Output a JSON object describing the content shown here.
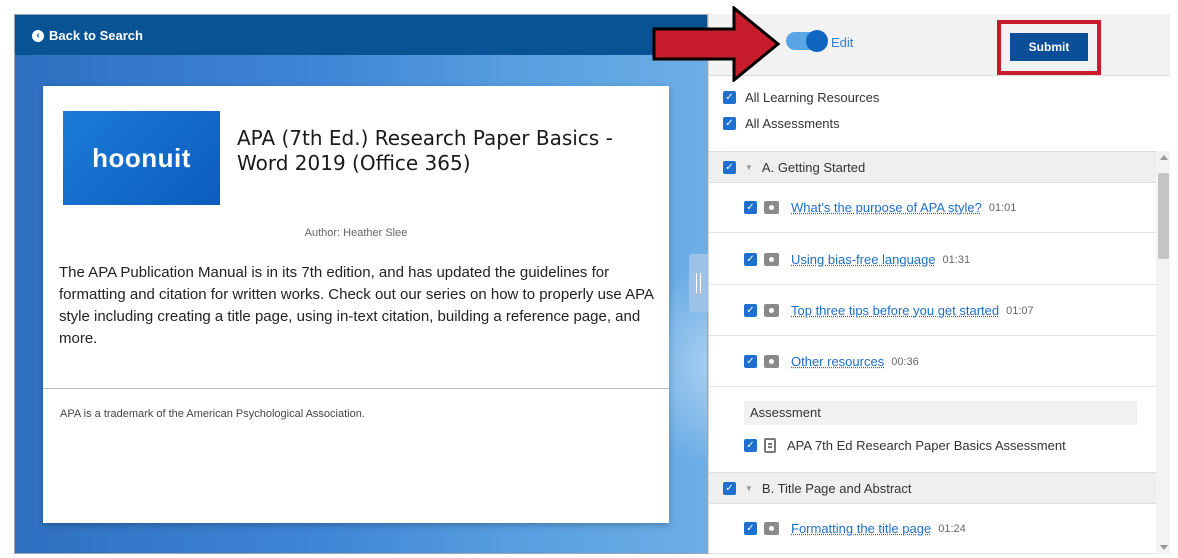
{
  "header": {
    "back_label": "Back to Search"
  },
  "course": {
    "logo_text": "hoonuit",
    "title": "APA (7th Ed.) Research Paper Basics - Word 2019 (Office 365)",
    "author": "Author: Heather Slee",
    "description": "The APA Publication Manual is in its 7th edition, and has updated the guidelines for formatting and citation for written works. Check out our series on how to properly use APA style including creating a title page, using in-text citation, building a reference page, and more.",
    "trademark": "APA is a trademark of the American Psychological Association."
  },
  "toolbar": {
    "edit_label": "Edit",
    "edit_enabled": true,
    "submit_label": "Submit"
  },
  "filters": [
    {
      "label": "All Learning Resources",
      "checked": true
    },
    {
      "label": "All Assessments",
      "checked": true
    }
  ],
  "sections": [
    {
      "title": "A. Getting Started",
      "checked": true,
      "lessons": [
        {
          "title": "What's the purpose of APA style?",
          "duration": "01:01",
          "checked": true
        },
        {
          "title": "Using bias-free language",
          "duration": "01:31",
          "checked": true
        },
        {
          "title": "Top three tips before you get started",
          "duration": "01:07",
          "checked": true
        },
        {
          "title": "Other resources",
          "duration": "00:36",
          "checked": true
        }
      ],
      "assessment_heading": "Assessment",
      "assessment": {
        "title": "APA 7th Ed Research Paper Basics Assessment",
        "checked": true
      }
    },
    {
      "title": "B. Title Page and Abstract",
      "checked": true,
      "lessons": [
        {
          "title": "Formatting the title page",
          "duration": "01:24",
          "checked": true
        }
      ]
    }
  ],
  "colors": {
    "topbar": "#075394",
    "accent_blue": "#1f6fd1",
    "submit_button": "#0b4f98",
    "highlight_red": "#c71c2b"
  },
  "icons": {
    "back": "back-arrow-circle-icon",
    "lesson": "camera-icon",
    "assessment": "assessment-doc-icon",
    "caret": "caret-down-icon"
  }
}
